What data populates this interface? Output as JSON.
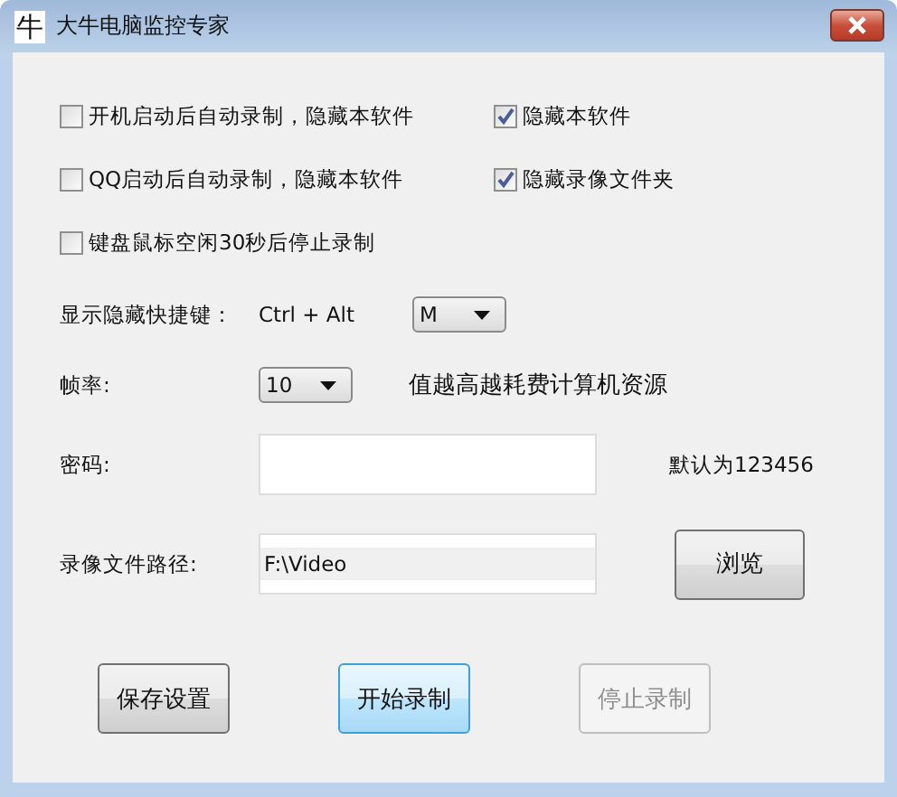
{
  "window": {
    "icon_text": "牛",
    "title": "大牛电脑监控专家"
  },
  "options": [
    {
      "label": "开机启动后自动录制，隐藏本软件",
      "checked": false
    },
    {
      "label": "隐藏本软件",
      "checked": true
    },
    {
      "label": "QQ启动后自动录制，隐藏本软件",
      "checked": false
    },
    {
      "label": "隐藏录像文件夹",
      "checked": true
    },
    {
      "label": "键盘鼠标空闲30秒后停止录制",
      "checked": false
    }
  ],
  "hotkey": {
    "label": "显示隐藏快捷键：",
    "modifiers": "Ctrl + Alt",
    "key": "M"
  },
  "frame_rate": {
    "label": "帧率:",
    "value": "10",
    "note": "值越高越耗费计算机资源"
  },
  "password": {
    "label": "密码:",
    "note": "默认为123456"
  },
  "path": {
    "label": "录像文件路径:",
    "value": "F:\\Video",
    "button": "浏览"
  },
  "buttons": [
    {
      "label": "保存设置",
      "focused": false,
      "disabled": false
    },
    {
      "label": "开始录制",
      "focused": true,
      "disabled": false
    },
    {
      "label": "停止录制",
      "focused": false,
      "disabled": true
    }
  ]
}
